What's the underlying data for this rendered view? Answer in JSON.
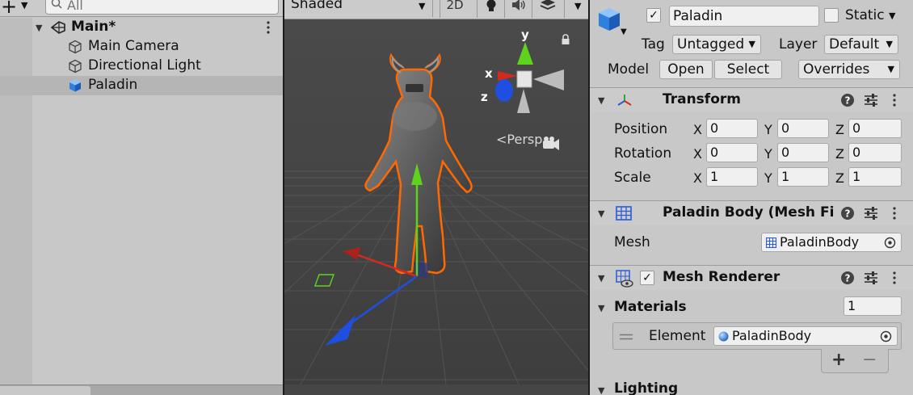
{
  "hierarchy": {
    "search_placeholder": "All",
    "scene_name": "Main*",
    "items": [
      {
        "label": "Main Camera"
      },
      {
        "label": "Directional Light"
      },
      {
        "label": "Paladin"
      }
    ]
  },
  "scene_view": {
    "shading_mode": "Shaded",
    "mode_2d": "2D",
    "projection_label": "<Persp",
    "gizmo": {
      "x": "x",
      "y": "y",
      "z": "z"
    }
  },
  "inspector": {
    "object_name": "Paladin",
    "active": true,
    "static_label": "Static",
    "tag_label": "Tag",
    "tag_value": "Untagged",
    "layer_label": "Layer",
    "layer_value": "Default",
    "model_label": "Model",
    "open_btn": "Open",
    "select_btn": "Select",
    "overrides_btn": "Overrides",
    "transform": {
      "title": "Transform",
      "position_label": "Position",
      "rotation_label": "Rotation",
      "scale_label": "Scale",
      "axis_x": "X",
      "axis_y": "Y",
      "axis_z": "Z",
      "position": [
        "0",
        "0",
        "0"
      ],
      "rotation": [
        "0",
        "0",
        "0"
      ],
      "scale": [
        "1",
        "1",
        "1"
      ]
    },
    "mesh_filter": {
      "title": "Paladin Body (Mesh Fi",
      "mesh_label": "Mesh",
      "mesh_value": "PaladinBody"
    },
    "mesh_renderer": {
      "title": "Mesh Renderer",
      "enabled": true,
      "materials_label": "Materials",
      "materials_count": "1",
      "element_label": "Element",
      "element_value": "PaladinBody",
      "add_btn": "+",
      "remove_btn": "−"
    },
    "lighting_label": "Lighting"
  },
  "colors": {
    "panel": "#c8c8c8",
    "scene_bg": "#464646",
    "selection_outline": "#ff6a00",
    "axis_x": "#d42a1e",
    "axis_y": "#5fd21e",
    "axis_z": "#1e4fe0"
  }
}
